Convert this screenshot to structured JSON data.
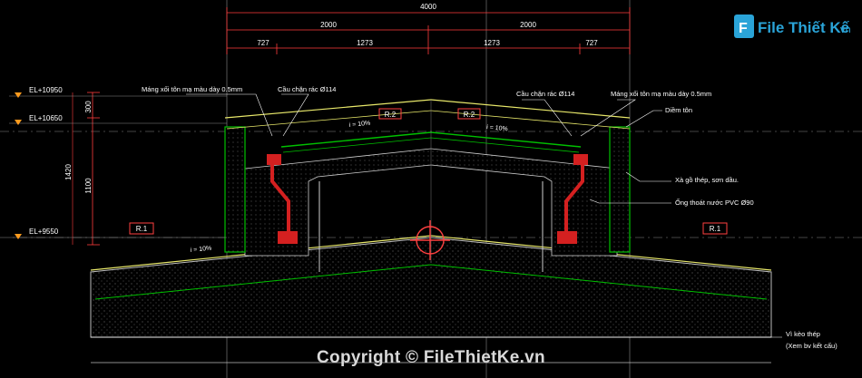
{
  "dimensions": {
    "total": "4000",
    "left_half": "2000",
    "right_half": "2000",
    "left_outer": "727",
    "left_inner": "1273",
    "right_inner": "1273",
    "right_outer": "727",
    "vertical_top": "300",
    "vertical_total": "1420",
    "vertical_lower": "1100"
  },
  "elevations": {
    "top": "EL+10950",
    "middle": "EL+10650",
    "bottom": "EL+9550"
  },
  "slopes": {
    "roof_left": "i = 10%",
    "roof_right": "i = 10%",
    "lower_left": "i = 10%"
  },
  "tags": {
    "r2_left": "R.2",
    "r2_right": "R.2",
    "r1_left": "R.1",
    "r1_right": "R.1"
  },
  "annotations": {
    "gutter_left": "Máng xối tôn mạ màu dày 0.5mm",
    "grate_left": "Cầu chặn rác Ø114",
    "grate_right": "Cầu chặn rác Ø114",
    "gutter_right": "Máng xối tôn mạ màu dày 0.5mm",
    "ridge_tile": "Diềm tôn",
    "steel_purlin": "Xà gồ thép, sơn dầu.",
    "drain_pipe": "Ống thoát nước PVC Ø90",
    "steel_truss": "Vì kèo thép",
    "steel_truss_ref": "(Xem bv kết cấu)"
  },
  "watermark": {
    "logo_text": "File Thiết Kế",
    "logo_suffix": ".vn",
    "copyright": "Copyright © FileThietKe.vn"
  },
  "colors": {
    "background": "#000000",
    "dimension": "#ff3b3b",
    "structure": "#00c000",
    "roof_line": "#e8e86a",
    "tag": "#ff4040",
    "annotation": "#ffffff",
    "pipe": "#d42020",
    "logo": "#2aa4d8"
  }
}
